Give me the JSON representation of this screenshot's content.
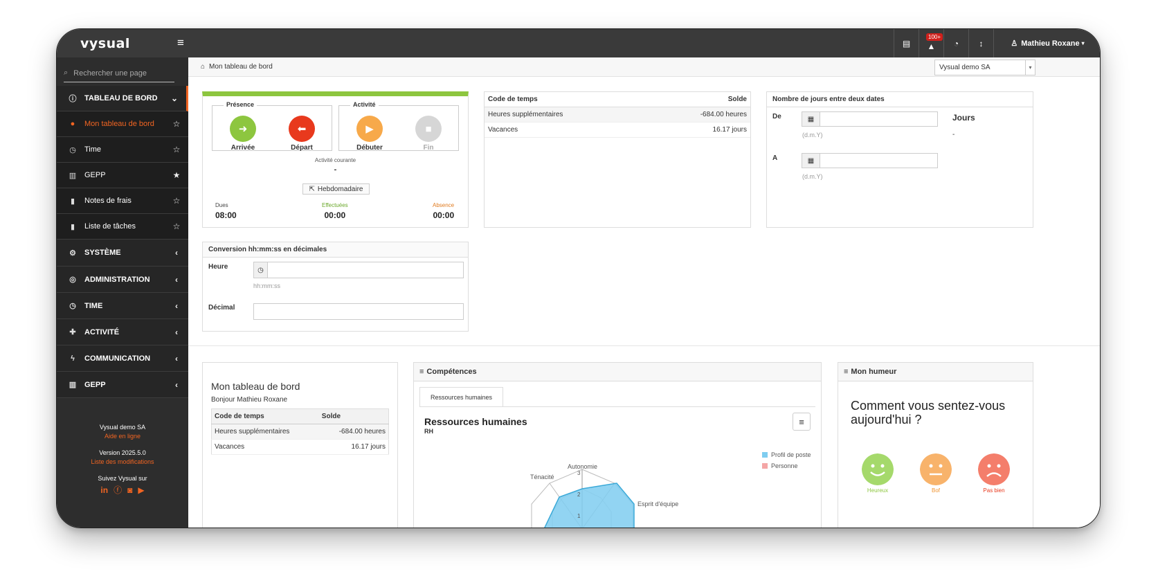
{
  "app": {
    "logo": "vysual",
    "menu_icon": "hamburger-icon"
  },
  "topbar": {
    "alert_badge": "100+",
    "user_name": "Mathieu Roxane"
  },
  "sidebar": {
    "search_placeholder": "Rechercher une page",
    "items": [
      {
        "label": "TABLEAU DE BORD",
        "icon": "info-icon"
      },
      {
        "label": "Mon tableau de bord",
        "icon": "info-icon"
      },
      {
        "label": "Time",
        "icon": "clock-icon"
      },
      {
        "label": "GEPP",
        "icon": "chart-icon"
      },
      {
        "label": "Notes de frais",
        "icon": "document-icon"
      },
      {
        "label": "Liste de tâches",
        "icon": "clipboard-icon"
      },
      {
        "label": "SYSTÈME",
        "icon": "cogs-icon"
      },
      {
        "label": "ADMINISTRATION",
        "icon": "target-icon"
      },
      {
        "label": "TIME",
        "icon": "clock-icon"
      },
      {
        "label": "ACTIVITÉ",
        "icon": "puzzle-icon"
      },
      {
        "label": "COMMUNICATION",
        "icon": "bolt-icon"
      },
      {
        "label": "GEPP",
        "icon": "chart-icon"
      }
    ],
    "footer": {
      "company": "Vysual demo SA",
      "help": "Aide en ligne",
      "version": "Version 2025.5.0",
      "changes": "Liste des modifications",
      "follow": "Suivez Vysual sur"
    }
  },
  "breadcrumb": {
    "label": "Mon tableau de bord"
  },
  "company_select": {
    "value": "Vysual demo SA"
  },
  "presence": {
    "group1": "Présence",
    "group2": "Activité",
    "arrivee": "Arrivée",
    "depart": "Départ",
    "debuter": "Débuter",
    "fin": "Fin",
    "current_label": "Activité courante",
    "current_value": "-",
    "weekly": "Hebdomadaire",
    "dues_label": "Dues",
    "dues_value": "08:00",
    "effectuees_label": "Effectuées",
    "effectuees_value": "00:00",
    "absence_label": "Absence",
    "absence_value": "00:00",
    "colors": {
      "green": "#8dc63f",
      "red": "#e8391d",
      "orange": "#f7a94a",
      "grey": "#d6d6d6"
    }
  },
  "codetemps": {
    "col1": "Code de temps",
    "col2": "Solde",
    "rows": [
      {
        "label": "Heures supplémentaires",
        "value": "-684.00 heures"
      },
      {
        "label": "Vacances",
        "value": "16.17 jours"
      }
    ]
  },
  "nbjours": {
    "title": "Nombre de jours entre deux dates",
    "de": "De",
    "a": "A",
    "hint": "(d.m.Y)",
    "jours_label": "Jours",
    "jours_value": "-"
  },
  "conversion": {
    "title": "Conversion hh:mm:ss en décimales",
    "heure": "Heure",
    "heure_hint": "hh:mm:ss",
    "decimal": "Décimal"
  },
  "dashboard": {
    "title": "Mon tableau de bord",
    "greeting": "Bonjour Mathieu Roxane",
    "col1": "Code de temps",
    "col2": "Solde",
    "rows": [
      {
        "label": "Heures supplémentaires",
        "value": "-684.00 heures"
      },
      {
        "label": "Vacances",
        "value": "16.17 jours"
      }
    ]
  },
  "competences": {
    "title": "Compétences",
    "tab": "Ressources humaines",
    "chart_title": "Ressources humaines",
    "chart_subtitle": "RH"
  },
  "chart_data": {
    "type": "radar",
    "title": "Ressources humaines",
    "subtitle": "RH",
    "axes": [
      "Autonomie",
      "Esprit d'équipe",
      "Ténacité"
    ],
    "scale_labels": [
      "1",
      "2",
      "3"
    ],
    "series": [
      {
        "name": "Profil de poste",
        "color": "#7fcdf0"
      },
      {
        "name": "Personne",
        "color": "#f4a6a6"
      }
    ]
  },
  "humeur": {
    "title": "Mon humeur",
    "question": "Comment vous sentez-vous aujourd'hui ?",
    "moods": [
      {
        "label": "Heureux",
        "color": "#a5d96b"
      },
      {
        "label": "Bof",
        "color": "#f8b36b"
      },
      {
        "label": "Pas bien",
        "color": "#f47e6b"
      }
    ]
  }
}
